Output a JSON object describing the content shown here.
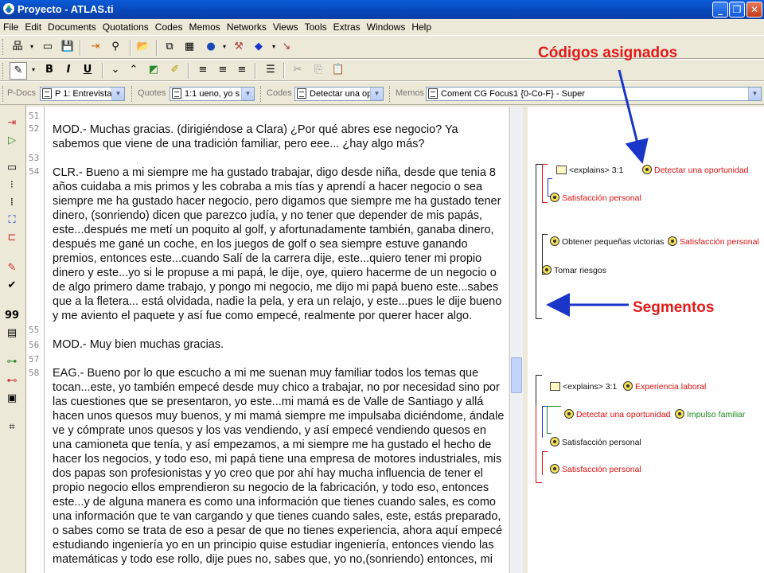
{
  "window": {
    "title": "Proyecto - ATLAS.ti"
  },
  "menu": [
    "File",
    "Edit",
    "Documents",
    "Quotations",
    "Codes",
    "Memos",
    "Networks",
    "Views",
    "Tools",
    "Extras",
    "Windows",
    "Help"
  ],
  "selectors": {
    "pdocs": {
      "label": "P-Docs",
      "value": "P 1: Entrevista"
    },
    "quotes": {
      "label": "Quotes",
      "value": "1:1 ueno, yo s"
    },
    "codes": {
      "label": "Codes",
      "value": "Detectar una op"
    },
    "memos": {
      "label": "Memos",
      "value": "Coment CG Focus1 {0-Co-F} - Super"
    }
  },
  "line_numbers": [
    "51",
    "52",
    "53",
    "54",
    "55",
    "56",
    "57",
    "58"
  ],
  "paragraphs": [
    "MOD.- Muchas gracias. (dirigiéndose a Clara) ¿Por qué abres ese negocio? Ya sabemos que viene de una tradición familiar, pero eee... ¿hay algo más?",
    "CLR.- Bueno a mi siempre me ha gustado trabajar, digo desde niña, desde que tenia 8 años cuidaba a mis primos y les cobraba a mis tías y aprendí a hacer negocio o sea siempre me ha gustado hacer negocio, pero digamos que siempre me ha gustado tener dinero, (sonriendo) dicen que parezco judía, y no tener que depender de mis papás, este...después me metí un poquito al golf, y afortunadamente también, ganaba dinero, después me gané un coche, en los juegos de golf o sea siempre estuve ganando premios, entonces este...cuando Salí de la carrera dije, este...quiero tener mi propio dinero y este...yo si le propuse a mi papá, le dije, oye, quiero hacerme de un negocio o de algo primero dame trabajo, y pongo mi negocio, me dijo mi papá bueno este...sabes que a la fletera... está olvidada, nadie la pela, y era un relajo, y este...pues le dije bueno y me aviento el paquete y así fue como empecé, realmente por querer hacer algo.",
    "MOD.- Muy bien muchas gracias.",
    "EAG.- Bueno por lo que escucho a mi me suenan muy familiar todos los temas que tocan...este, yo también empecé desde muy chico a trabajar, no por necesidad sino por las cuestiones que se presentaron, yo este...mi mamá es de Valle de Santiago y allá hacen unos quesos muy buenos, y mi mamá siempre me impulsaba diciéndome, ándale ve y cómprate unos quesos y los vas vendiendo, y así empecé vendiendo quesos en una camioneta que tenía, y así empezamos, a mi siempre me ha gustado el hecho de hacer los negocios, y todo eso, mi papá tiene una empresa de motores industriales, mis dos papas son profesionistas y yo creo que por ahí hay mucha influencia de tener el propio negocio ellos emprendieron su negocio de la fabricación, y todo eso, entonces este...y de alguna manera es como una información que tienes cuando sales, es como una información que te van cargando y que tienes cuando sales, este, estás preparado, o sabes como se trata de eso a pesar de que no tienes experiencia, ahora aquí empecé estudiando ingeniería yo en un principio quise estudiar ingeniería, entonces viendo las matemáticas y todo ese rollo, dije pues no, sabes que, yo no,(sonriendo) entonces, mi"
  ],
  "margin": {
    "explains1": "<explains> 3:1",
    "code_detectar1": "Detectar una oportunidad",
    "code_satisfaccion1": "Satisfacción personal",
    "code_obtener": "Obtener pequeñas victorias",
    "code_satisfaccion2": "Satisfacción personal",
    "code_tomar": "Tomar riesgos",
    "explains2": "<explains> 3:1",
    "code_experiencia": "Experiencia laboral",
    "code_detectar2": "Detectar una oportunidad",
    "code_impulso": "Impulso familiar",
    "code_satisfaccion3": "Satisfacción personal",
    "code_satisfaccion4": "Satisfacción personal"
  },
  "annotations": {
    "codes": "Códigos asignados",
    "segments": "Segmentos"
  },
  "colors": {
    "annotation": "#e31a1a",
    "arrow": "#1a35c8",
    "code_red": "#e01010",
    "code_green": "#1a8a1a"
  }
}
